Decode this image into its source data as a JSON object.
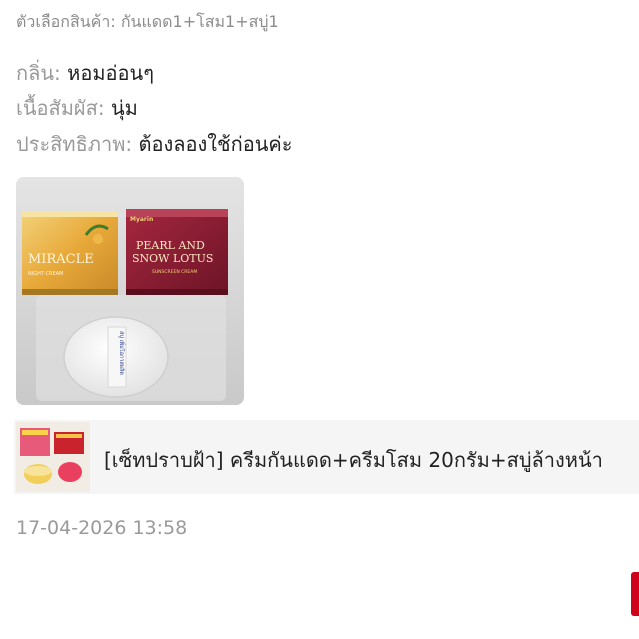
{
  "review": {
    "variation": "ตัวเลือกสินค้า: กันแดด1+โสม1+สบู่1",
    "attributes": [
      {
        "label": "กลิ่น:",
        "value": "หอมอ่อนๆ"
      },
      {
        "label": "เนื้อสัมผัส:",
        "value": "นุ่ม"
      },
      {
        "label": "ประสิทธิภาพ:",
        "value": "ต้องลองใช้ก่อนค่ะ"
      }
    ],
    "photo": {
      "box1_text": "MIRACLE",
      "box1_sub": "NIGHT CREAM",
      "box2_brand": "Myarin",
      "box2_line1": "PEARL AND",
      "box2_line2": "SNOW LOTUS",
      "box2_sub": "SUNSCREEN CREAM",
      "soap_text": "สบู่ เพิ่มโอกาสผลิต"
    },
    "product": {
      "title": "[เซ็ทปราบฝ้า] ครีมกันแดด+ครีมโสม 20กรัม+สบู่ล้างหน้า"
    },
    "timestamp": "17-04-2026 13:58"
  },
  "colors": {
    "accent": "#d0011b",
    "label": "#9a9a9a",
    "text": "#222222"
  }
}
